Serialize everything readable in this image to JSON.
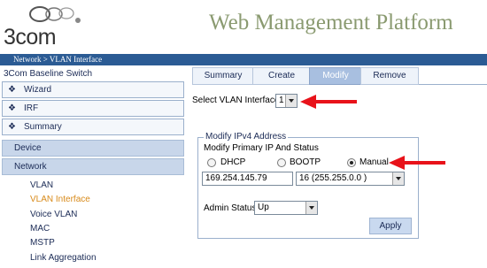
{
  "header": {
    "logo_text": "3com",
    "title": "Web Management Platform"
  },
  "breadcrumb": "Network > VLAN Interface",
  "sidebar": {
    "title": "3Com Baseline Switch",
    "boxes": [
      {
        "label": "Wizard"
      },
      {
        "label": "IRF"
      },
      {
        "label": "Summary"
      }
    ],
    "sections": [
      {
        "label": "Device"
      },
      {
        "label": "Network"
      }
    ],
    "items": [
      {
        "label": "VLAN"
      },
      {
        "label": "VLAN Interface"
      },
      {
        "label": "Voice VLAN"
      },
      {
        "label": "MAC"
      },
      {
        "label": "MSTP"
      },
      {
        "label": "Link Aggregation"
      }
    ]
  },
  "tabs": [
    {
      "label": "Summary"
    },
    {
      "label": "Create"
    },
    {
      "label": "Modify"
    },
    {
      "label": "Remove"
    }
  ],
  "form": {
    "select_vlan_label": "Select VLAN Interface",
    "select_vlan_value": "1",
    "ipv4_legend": "Modify IPv4 Address",
    "primary_label": "Modify Primary IP And Status",
    "radio_dhcp": "DHCP",
    "radio_bootp": "BOOTP",
    "radio_manual": "Manual",
    "selected_mode": "Manual",
    "ip_value": "169.254.145.79",
    "mask_value": "16 (255.255.0.0 )",
    "admin_label": "Admin Status",
    "admin_value": "Up",
    "apply_label": "Apply"
  },
  "colors": {
    "breadcrumb_bar": "#2b5b94",
    "title_text": "#8a9a70",
    "active_item": "#d88a1a",
    "arrow_red": "#e8121a"
  }
}
